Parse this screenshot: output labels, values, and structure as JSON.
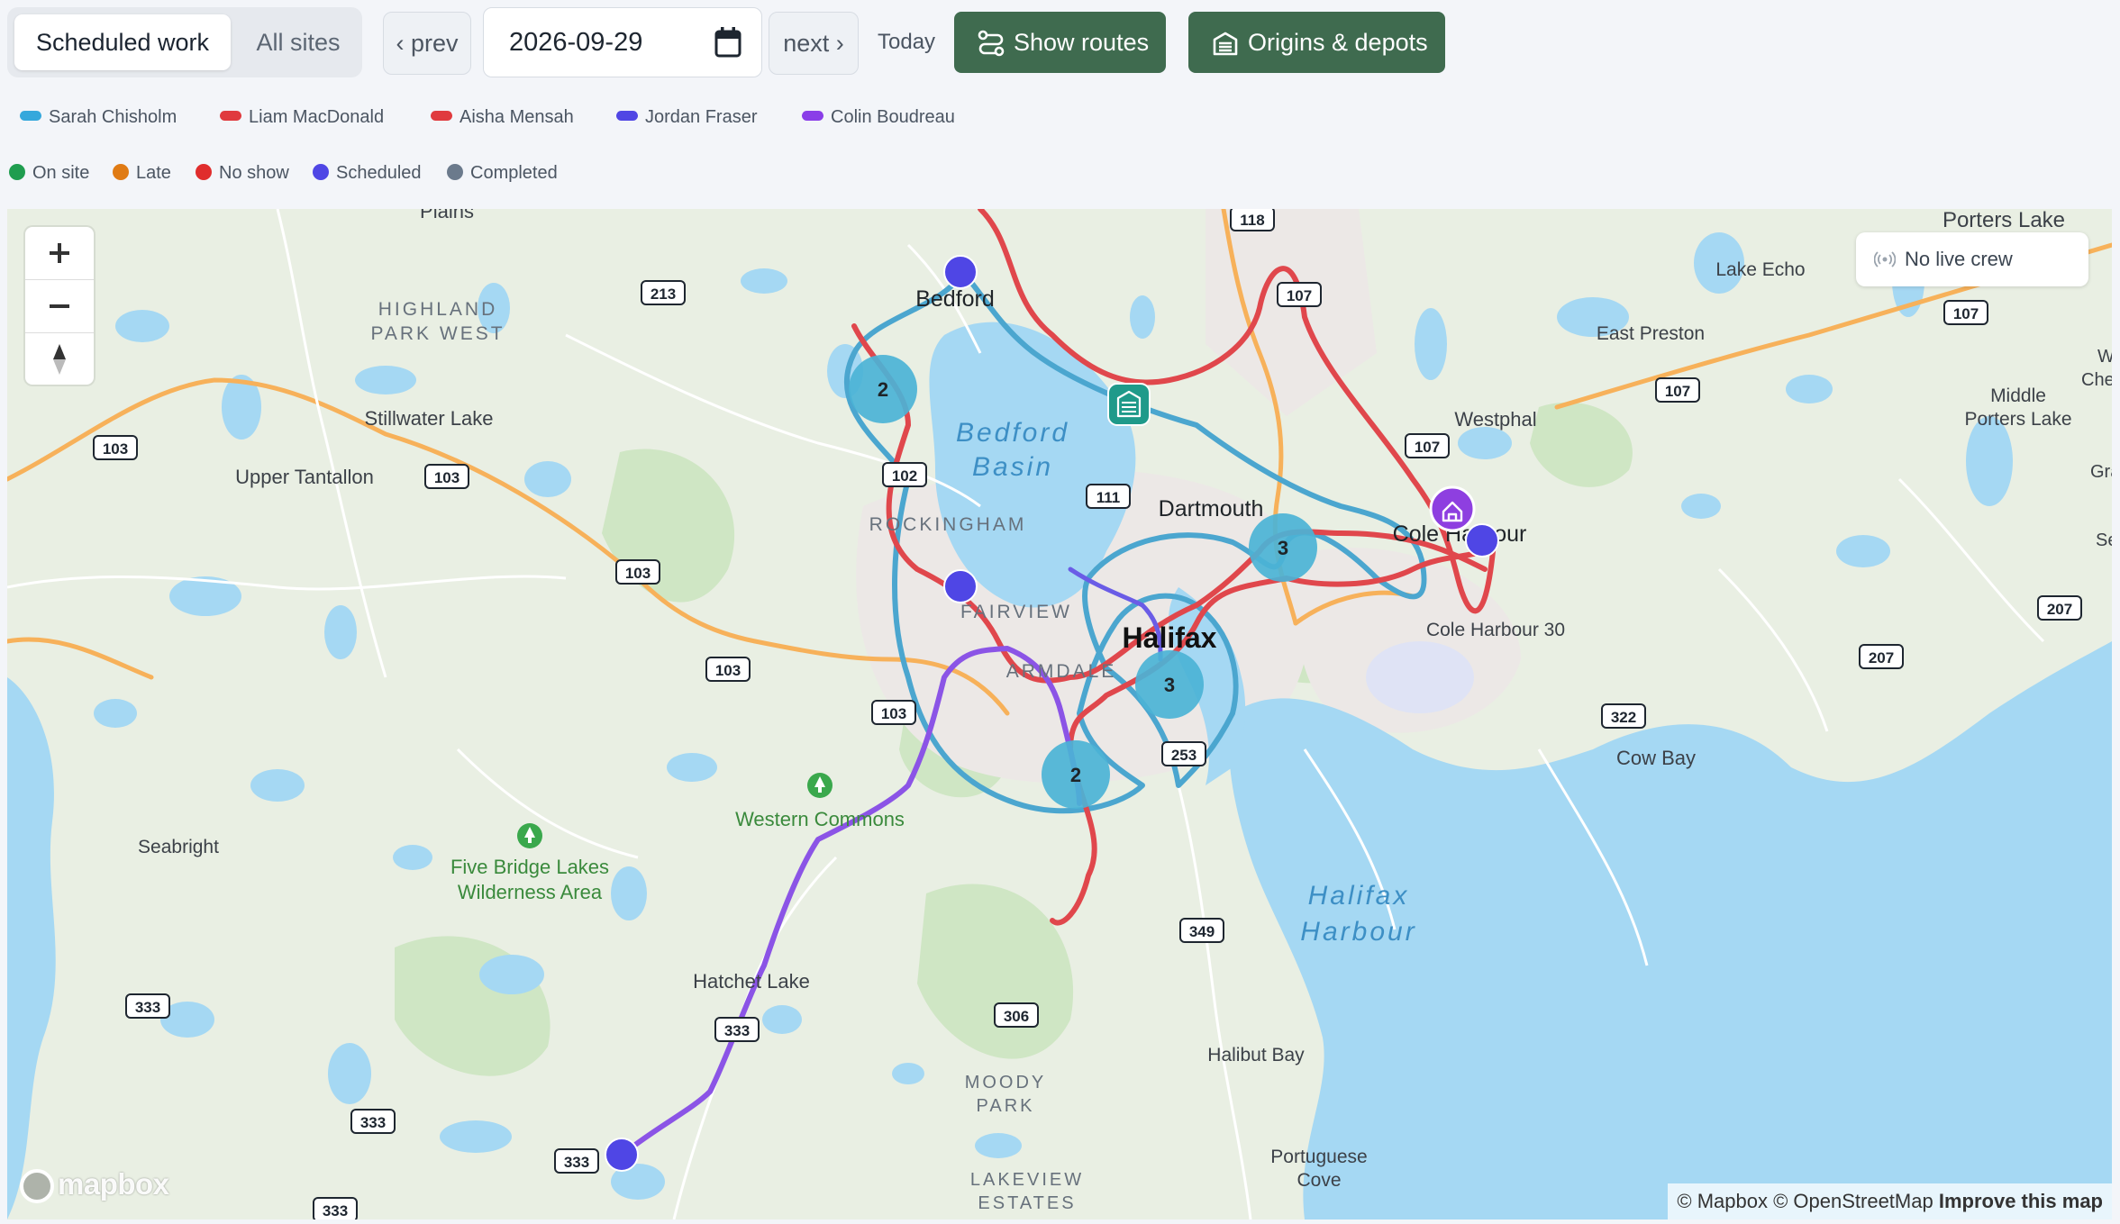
{
  "toolbar": {
    "tabs": [
      {
        "label": "Scheduled work",
        "active": true
      },
      {
        "label": "All sites",
        "active": false
      }
    ],
    "prev_label": "‹ prev",
    "date_value": "2026-09-29",
    "next_label": "next ›",
    "today_label": "Today",
    "show_routes_label": "Show routes",
    "origins_label": "Origins & depots"
  },
  "crew_legend": [
    {
      "name": "Sarah Chisholm",
      "color": "#35a8dc"
    },
    {
      "name": "Liam MacDonald",
      "color": "#e03a3e"
    },
    {
      "name": "Aisha Mensah",
      "color": "#e03a3e"
    },
    {
      "name": "Jordan Fraser",
      "color": "#5046e4"
    },
    {
      "name": "Colin Boudreau",
      "color": "#8a3ee8"
    }
  ],
  "status_legend": [
    {
      "name": "On site",
      "color": "#1f9d4f"
    },
    {
      "name": "Late",
      "color": "#e07b14"
    },
    {
      "name": "No show",
      "color": "#e02d2d"
    },
    {
      "name": "Scheduled",
      "color": "#4f46e5"
    },
    {
      "name": "Completed",
      "color": "#6b7a8c"
    }
  ],
  "map": {
    "place_labels": {
      "plains": "Plains",
      "highland_park_west": "HIGHLAND\nPARK WEST",
      "stillwater_lake": "Stillwater Lake",
      "upper_tantallon": "Upper Tantallon",
      "bedford": "Bedford",
      "bedford_basin": "Bedford\nBasin",
      "rockingham": "ROCKINGHAM",
      "fairview": "FAIRVIEW",
      "armdale": "ARMDALE",
      "halifax": "Halifax",
      "dartmouth": "Dartmouth",
      "cole_harbour": "Cole Harbour",
      "cole_harbour_30": "Cole Harbour 30",
      "westphal": "Westphal",
      "east_preston": "East Preston",
      "lake_echo": "Lake Echo",
      "porters_lake": "Porters Lake",
      "middle_porters_lake": "Middle\nPorters Lake",
      "cow_bay": "Cow Bay",
      "halifax_harbour": "Halifax\nHarbour",
      "halibut_bay": "Halibut Bay",
      "portuguese_cove": "Portuguese\nCove",
      "moody_park": "MOODY\nPARK",
      "lakeview_estates": "LAKEVIEW\nESTATES",
      "hatchet_lake": "Hatchet Lake",
      "western_commons": "Western Commons",
      "five_bridge_lakes": "Five Bridge Lakes\nWilderness Area",
      "seabright": "Seabright",
      "chezz": "Chezz",
      "gra": "Gra",
      "se": "Se",
      "w": "W"
    },
    "road_shields": [
      "118",
      "107",
      "107",
      "107",
      "107",
      "213",
      "103",
      "103",
      "103",
      "103",
      "103",
      "102",
      "111",
      "253",
      "349",
      "306",
      "333",
      "333",
      "333",
      "333",
      "333",
      "322",
      "207",
      "207"
    ],
    "clusters": [
      {
        "label": "2",
        "color": "#4bb3d6"
      },
      {
        "label": "3",
        "color": "#4bb3d6"
      },
      {
        "label": "3",
        "color": "#4bb3d6"
      },
      {
        "label": "2",
        "color": "#4bb3d6"
      }
    ],
    "live_crew_label": "No live crew",
    "attribution": "© Mapbox © OpenStreetMap",
    "improve_label": "Improve this map",
    "logo_text": "mapbox"
  }
}
